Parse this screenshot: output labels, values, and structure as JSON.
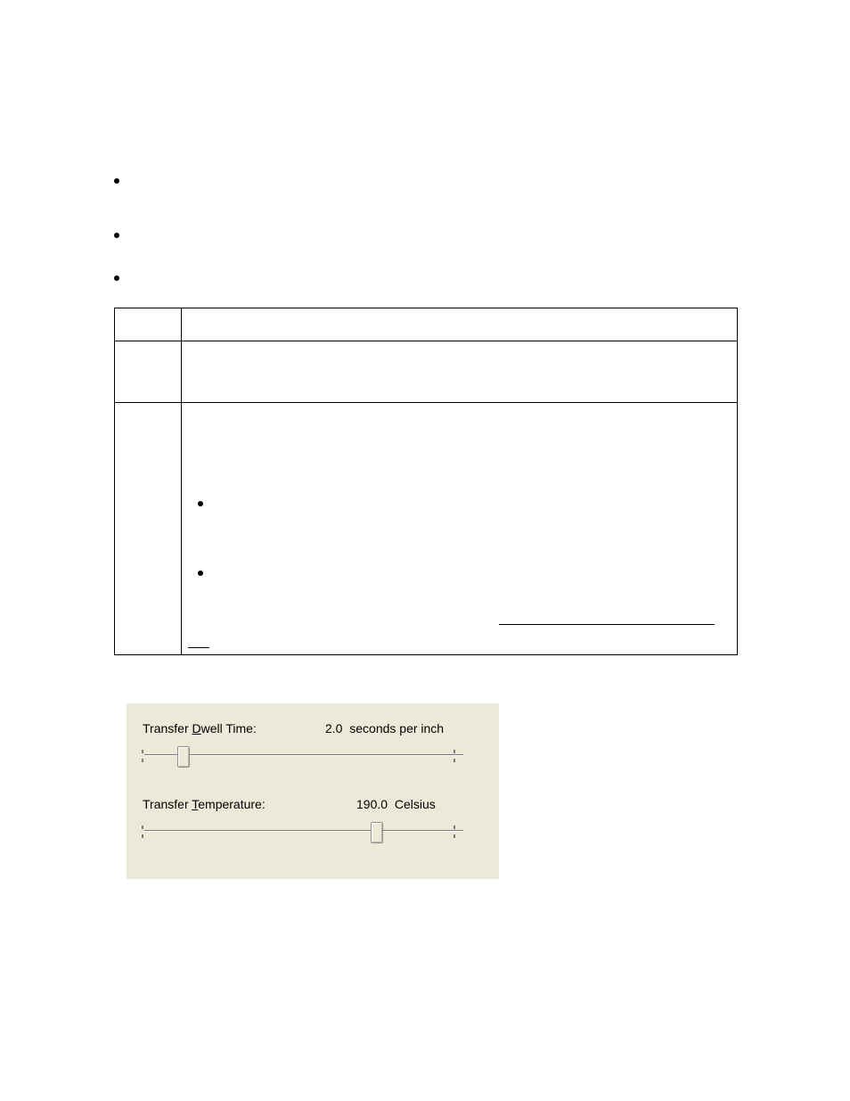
{
  "panel": {
    "dwell": {
      "label_prefix": "Transfer ",
      "label_underlined": "D",
      "label_suffix": "well Time:",
      "value": "2.0",
      "unit": "seconds per inch",
      "slider_percent": 11,
      "tick_left_percent": 0,
      "tick_right_percent": 100
    },
    "temp": {
      "label_prefix": "Transfer ",
      "label_underlined": "T",
      "label_suffix": "emperature:",
      "value": "190.0",
      "unit": "Celsius",
      "slider_percent": 73,
      "tick_left_percent": 0,
      "tick_right_percent": 100
    }
  }
}
